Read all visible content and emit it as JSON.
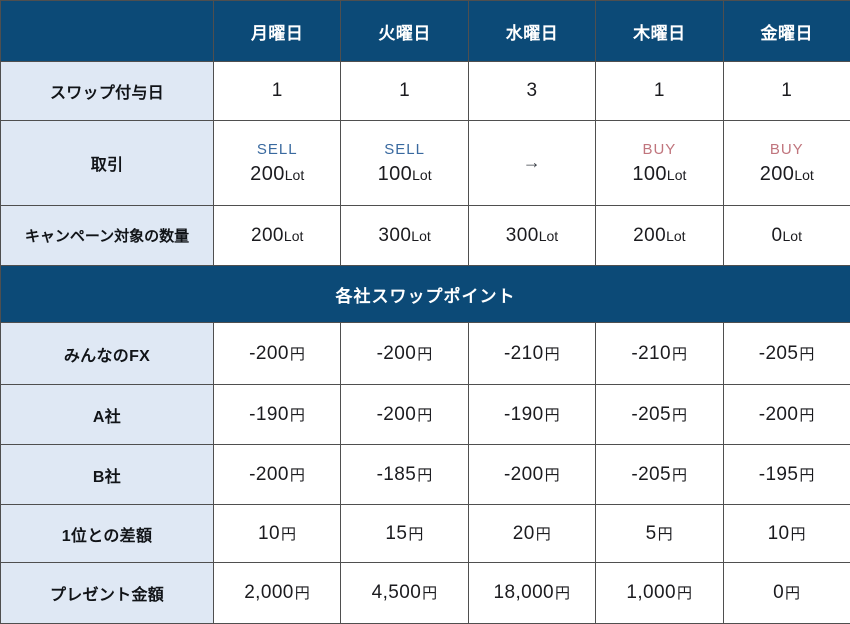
{
  "table": {
    "corner_label": "",
    "day_headers": [
      "月曜日",
      "火曜日",
      "水曜日",
      "木曜日",
      "金曜日"
    ],
    "section_banner": "各社スワップポイント",
    "rows": {
      "swap_day": {
        "label": "スワップ付与日",
        "values": [
          "1",
          "1",
          "3",
          "1",
          "1"
        ]
      },
      "trade": {
        "label": "取引",
        "cells": [
          {
            "side": "SELL",
            "side_type": "sell",
            "qty": "200",
            "unit": "Lot"
          },
          {
            "side": "SELL",
            "side_type": "sell",
            "qty": "100",
            "unit": "Lot"
          },
          {
            "side": "",
            "side_type": "arrow",
            "qty": "→",
            "unit": ""
          },
          {
            "side": "BUY",
            "side_type": "buy",
            "qty": "100",
            "unit": "Lot"
          },
          {
            "side": "BUY",
            "side_type": "buy",
            "qty": "200",
            "unit": "Lot"
          }
        ]
      },
      "campaign_target": {
        "label": "キャンペーン対象の数量",
        "values": [
          "200",
          "300",
          "300",
          "200",
          "0"
        ],
        "unit": "Lot"
      },
      "minna_fx": {
        "label": "みんなのFX",
        "values": [
          "-200",
          "-200",
          "-210",
          "-210",
          "-205"
        ],
        "unit": "円"
      },
      "company_a": {
        "label": "A社",
        "values": [
          "-190",
          "-200",
          "-190",
          "-205",
          "-200"
        ],
        "unit": "円"
      },
      "company_b": {
        "label": "B社",
        "values": [
          "-200",
          "-185",
          "-200",
          "-205",
          "-195"
        ],
        "unit": "円"
      },
      "diff_from_first": {
        "label": "1位との差額",
        "values": [
          "10",
          "15",
          "20",
          "5",
          "10"
        ],
        "unit": "円"
      },
      "present_amount": {
        "label": "プレゼント金額",
        "values": [
          "2,000",
          "4,500",
          "18,000",
          "1,000",
          "0"
        ],
        "unit": "円"
      }
    }
  },
  "colors": {
    "header_blue": "#0c4a77",
    "label_fill": "#dfe8f4",
    "sell_blue": "#39699f",
    "buy_red": "#c0757d",
    "grid_line": "#4f4f4f",
    "text_dark": "#1b1b1f"
  }
}
